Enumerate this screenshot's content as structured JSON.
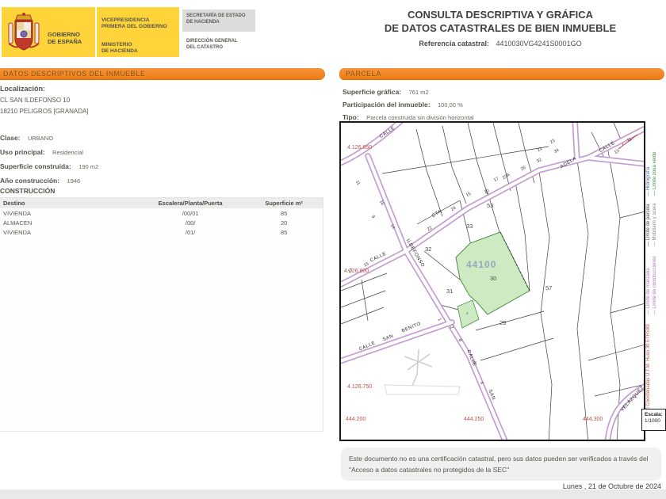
{
  "header": {
    "gov_line1": "GOBIERNO",
    "gov_line2": "DE ESPAÑA",
    "dept_line1": "VICEPRESIDENCIA",
    "dept_line2": "PRIMERA DEL GOBIERNO",
    "dept_line3": "MINISTERIO",
    "dept_line4": "DE HACIENDA",
    "sec_line1": "SECRETARÍA DE ESTADO",
    "sec_line2": "DE HACIENDA",
    "dir_line1": "DIRECCIÓN GENERAL",
    "dir_line2": "DEL CATASTRO",
    "title_line1": "CONSULTA DESCRIPTIVA Y GRÁFICA",
    "title_line2": "DE DATOS CATASTRALES DE BIEN INMUEBLE",
    "ref_label": "Referencia catastral:",
    "ref_value": "4410030VG4241S0001GO"
  },
  "left": {
    "section_title": "DATOS DESCRIPTIVOS DEL INMUEBLE",
    "localizacion_label": "Localización:",
    "address_line1": "CL SAN ILDEFONSO 10",
    "address_line2": "18210 PELIGROS [GRANADA]",
    "fields": [
      {
        "label": "Clase:",
        "value": "URBANO"
      },
      {
        "label": "Uso principal:",
        "value": "Residencial"
      },
      {
        "label": "Superficie construida:",
        "value": "190 m2"
      },
      {
        "label": "Año construcción:",
        "value": "1946"
      }
    ],
    "construccion": {
      "title": "CONSTRUCCIÓN",
      "columns": [
        "Destino",
        "Escalera/Planta/Puerta",
        "Superficie m²"
      ],
      "rows": [
        [
          "VIVIENDA",
          "/00/01",
          "85"
        ],
        [
          "ALMACEN",
          "/00/",
          "20"
        ],
        [
          "VIVIENDA",
          "/01/",
          "85"
        ]
      ]
    }
  },
  "right": {
    "section_title": "PARCELA",
    "fields": [
      {
        "label": "Superficie gráfica:",
        "value": "761 m2"
      },
      {
        "label": "Participación del inmueble:",
        "value": "100,00 %"
      },
      {
        "label": "Tipo:",
        "value": "Parcela construida sin división horizontal"
      }
    ]
  },
  "map": {
    "labels": [
      {
        "t": "4.126.850"
      },
      {
        "t": "4.126.800"
      },
      {
        "t": "4.126.750"
      },
      {
        "t": "444.200"
      },
      {
        "t": "444.250"
      },
      {
        "t": "444.300"
      },
      {
        "t": "CALLE"
      },
      {
        "t": "CTA"
      },
      {
        "t": "ADELA"
      },
      {
        "t": "CALLE"
      },
      {
        "t": "ILDEFONSO"
      },
      {
        "t": "CALLE"
      },
      {
        "t": "SAN"
      },
      {
        "t": "BENITO"
      },
      {
        "t": "CALLE"
      },
      {
        "t": "SAN"
      },
      {
        "t": "VELÁZQUEZ"
      },
      {
        "t": "CALLE"
      },
      {
        "t": "11"
      },
      {
        "t": "16"
      },
      {
        "t": "9"
      },
      {
        "t": "14"
      },
      {
        "t": "22"
      },
      {
        "t": "24"
      },
      {
        "t": "15"
      },
      {
        "t": "20"
      },
      {
        "t": "17"
      },
      {
        "t": "23A"
      },
      {
        "t": "26"
      },
      {
        "t": "21"
      },
      {
        "t": "32"
      },
      {
        "t": "23"
      },
      {
        "t": "34"
      },
      {
        "t": "13"
      },
      {
        "t": "11"
      },
      {
        "t": "15"
      },
      {
        "t": "17"
      },
      {
        "t": "1"
      },
      {
        "t": "12"
      },
      {
        "t": "8"
      },
      {
        "t": "6"
      },
      {
        "t": "4"
      },
      {
        "t": "4"
      },
      {
        "t": "53"
      },
      {
        "t": "33"
      },
      {
        "t": "32"
      },
      {
        "t": "31"
      },
      {
        "t": "29"
      },
      {
        "t": "57"
      },
      {
        "t": "30"
      },
      {
        "t": "44100"
      }
    ],
    "legend": {
      "items": [
        {
          "text": "— Límite de parcela"
        },
        {
          "text": "— Hidrografía"
        },
        {
          "text": "— Mobiliario y acera"
        },
        {
          "text": "— Límite zona verde"
        },
        {
          "text": "— Límite de manzana"
        },
        {
          "text": "— Límite de construcciones"
        }
      ],
      "utm_note": "444.300 Coordenadas U.T.M. Huso 30 ETRS89"
    },
    "scale": {
      "label": "Escala:",
      "value": "1/1000"
    }
  },
  "footer": {
    "disclaimer": "Este documento no es una certificación catastral, pero sus datos pueden ser verificados a través del \"Acceso a datos catastrales no protegidos de la SEC\"",
    "date": "Lunes , 21 de Octubre de 2024"
  },
  "colors": {
    "accent_orange": "#EF7C14",
    "gov_yellow": "#FFD43B",
    "street_purple": "#C49BD1",
    "parcel_green": "#CDEAC2",
    "coordinate_red": "#C0544A"
  }
}
